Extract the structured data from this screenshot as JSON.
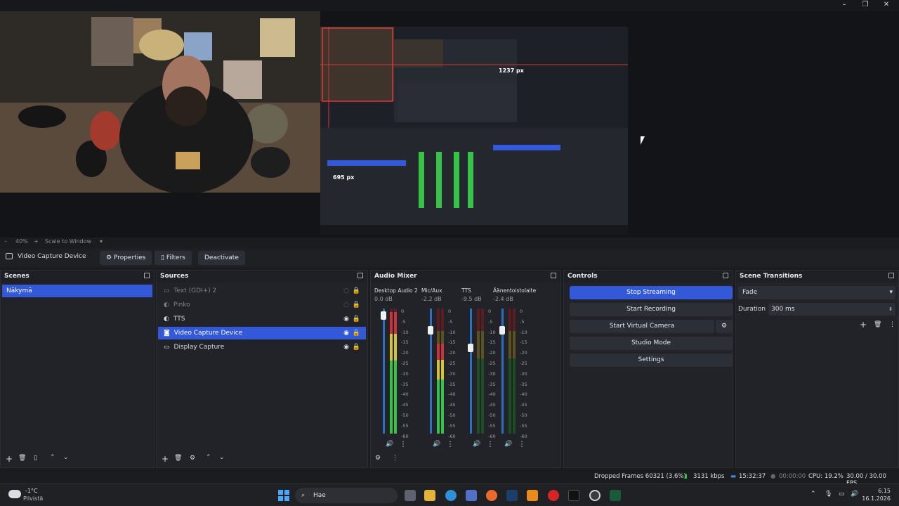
{
  "window": {
    "minimize": "–",
    "maximize": "❐",
    "close": "✕"
  },
  "preview": {
    "measure_h": "1237 px",
    "measure_v": "695 px"
  },
  "zoom": {
    "level": "40%",
    "mode": "Scale to Window"
  },
  "context": {
    "source": "Video Capture Device",
    "properties": "Properties",
    "filters": "Filters",
    "deactivate": "Deactivate"
  },
  "scenes": {
    "title": "Scenes",
    "items": [
      "Näkymä"
    ]
  },
  "sources": {
    "title": "Sources",
    "items": [
      "Text (GDI+) 2",
      "Pinko",
      "TTS",
      "Video Capture Device",
      "Display Capture"
    ]
  },
  "mixer": {
    "title": "Audio Mixer",
    "channels": [
      {
        "name": "Desktop Audio 2",
        "db": "0.0 dB",
        "level": 0.97,
        "fader": 0.98
      },
      {
        "name": "Mic/Aux",
        "db": "-2.2 dB",
        "level": 0.72,
        "fader": 0.86
      },
      {
        "name": "TTS",
        "db": "-9.5 dB",
        "level": 0.0,
        "fader": 0.72
      },
      {
        "name": "Äänentoistolaite",
        "db": "-2.4 dB",
        "level": 0.0,
        "fader": 0.86
      }
    ],
    "scale": [
      "0",
      "-5",
      "-10",
      "-15",
      "-20",
      "-25",
      "-30",
      "-35",
      "-40",
      "-45",
      "-50",
      "-55",
      "-60"
    ]
  },
  "controls": {
    "title": "Controls",
    "stop_streaming": "Stop Streaming",
    "start_recording": "Start Recording",
    "start_virtual": "Start Virtual Camera",
    "studio_mode": "Studio Mode",
    "settings": "Settings"
  },
  "transitions": {
    "title": "Scene Transitions",
    "selected": "Fade",
    "duration_label": "Duration",
    "duration_value": "300 ms"
  },
  "status": {
    "dropped": "Dropped Frames 60321 (3.6%)",
    "bitrate": "3131 kbps",
    "live": "15:32:37",
    "rec": "00:00:00",
    "cpu": "CPU: 19.2%",
    "fps": "30.00 / 30.00 FPS"
  },
  "taskbar": {
    "weather_temp": "-1°C",
    "weather_desc": "Pilvistä",
    "search": "Hae",
    "time": "6.15",
    "date": "16.1.2026"
  },
  "colors": {
    "accent": "#3459d8",
    "live": "#3a8ee6",
    "meter_green": "#39c24a",
    "meter_yellow": "#d6c23a",
    "meter_red": "#c8343a"
  }
}
